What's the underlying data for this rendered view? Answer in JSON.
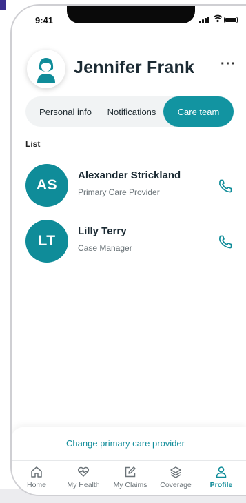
{
  "status_bar": {
    "time": "9:41"
  },
  "header": {
    "name": "Jennifer Frank",
    "more_label": "···"
  },
  "tabs": [
    {
      "label": "Personal info",
      "active": false
    },
    {
      "label": "Notifications",
      "active": false
    },
    {
      "label": "Care team",
      "active": true
    }
  ],
  "list": {
    "label": "List",
    "items": [
      {
        "initials": "AS",
        "name": "Alexander Strickland",
        "role": "Primary Care Provider"
      },
      {
        "initials": "LT",
        "name": "Lilly Terry",
        "role": "Case Manager"
      }
    ]
  },
  "action": {
    "label": "Change primary care provider"
  },
  "bottom_nav": [
    {
      "label": "Home",
      "icon": "home-icon",
      "active": false
    },
    {
      "label": "My Health",
      "icon": "health-icon",
      "active": false
    },
    {
      "label": "My Claims",
      "icon": "edit-icon",
      "active": false
    },
    {
      "label": "Coverage",
      "icon": "layers-icon",
      "active": false
    },
    {
      "label": "Profile",
      "icon": "profile-icon",
      "active": true
    }
  ],
  "colors": {
    "accent": "#0f8c99",
    "tab_active": "#1294a1",
    "text": "#1b2a33"
  }
}
